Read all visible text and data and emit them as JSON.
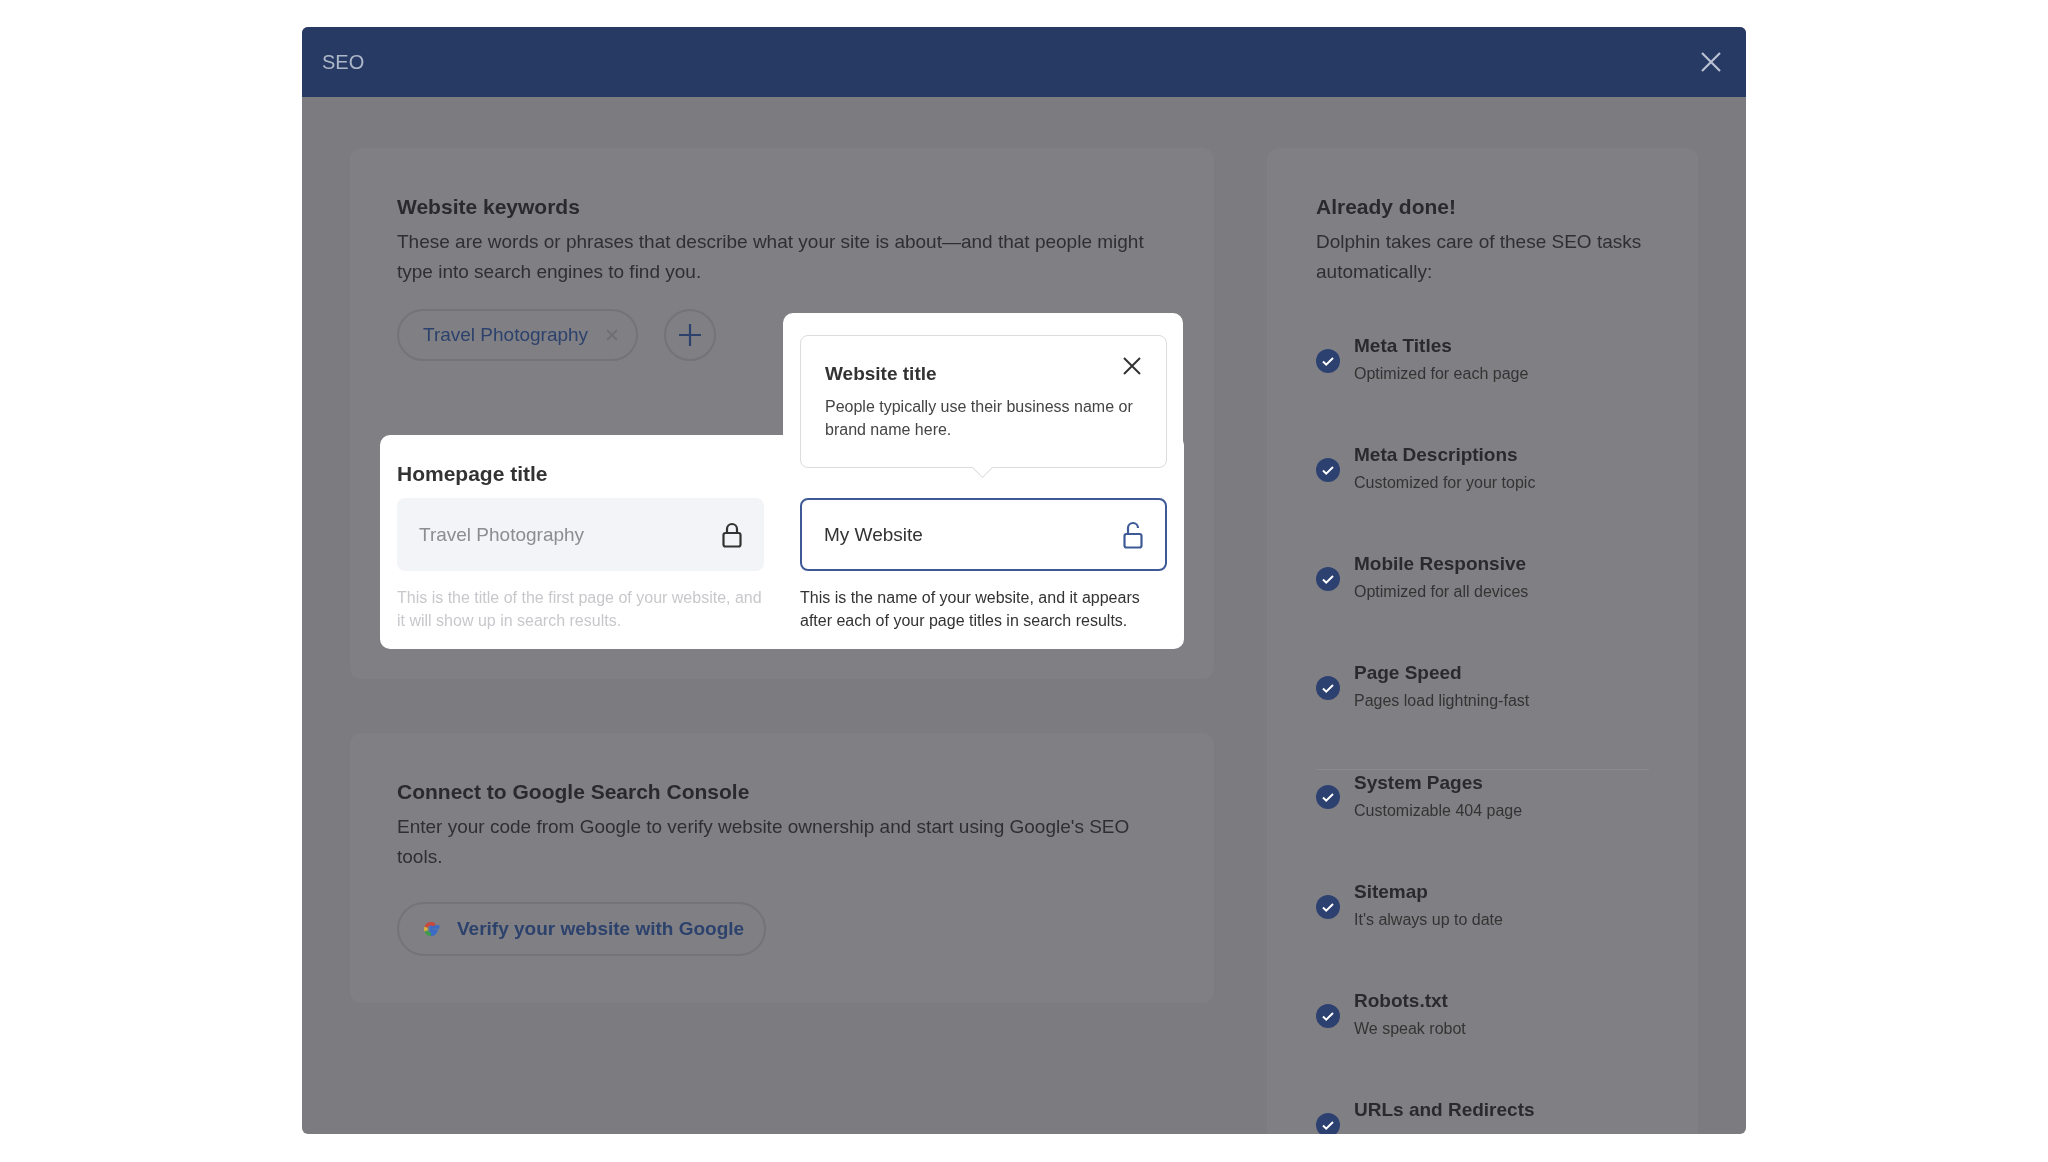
{
  "window": {
    "title": "SEO"
  },
  "keywords": {
    "title": "Website keywords",
    "description": "These are words or phrases that describe what your site is about—and that people might type into search engines to find you.",
    "chips": [
      {
        "label": "Travel Photography"
      }
    ]
  },
  "fields": [
    {
      "label": "Homepage title",
      "value": "Travel Photography",
      "locked": true,
      "help": "This is the title of the first page of your website, and it will show up in search results."
    },
    {
      "value": "My Website",
      "locked": false,
      "help": "This is the name of your website, and it appears after each of your page titles in search results."
    }
  ],
  "tooltip": {
    "title": "Website title",
    "text": "People typically use their business name or brand name here."
  },
  "google": {
    "title": "Connect to Google Search Console",
    "description": "Enter your code from Google to verify website ownership and start using Google's SEO tools.",
    "button": "Verify your website with Google"
  },
  "done": {
    "title": "Already done!",
    "description": "Dolphin takes care of these SEO tasks automatically:",
    "items": [
      {
        "title": "Meta Titles",
        "subtitle": "Optimized for each page"
      },
      {
        "title": "Meta Descriptions",
        "subtitle": "Customized for your topic"
      },
      {
        "title": "Mobile Responsive",
        "subtitle": "Optimized for all devices"
      },
      {
        "title": "Page Speed",
        "subtitle": "Pages load lightning-fast"
      },
      {
        "title": "System Pages",
        "subtitle": "Customizable 404 page"
      },
      {
        "title": "Sitemap",
        "subtitle": "It's always up to date"
      },
      {
        "title": "Robots.txt",
        "subtitle": "We speak robot"
      },
      {
        "title": "URLs and Redirects"
      }
    ]
  }
}
